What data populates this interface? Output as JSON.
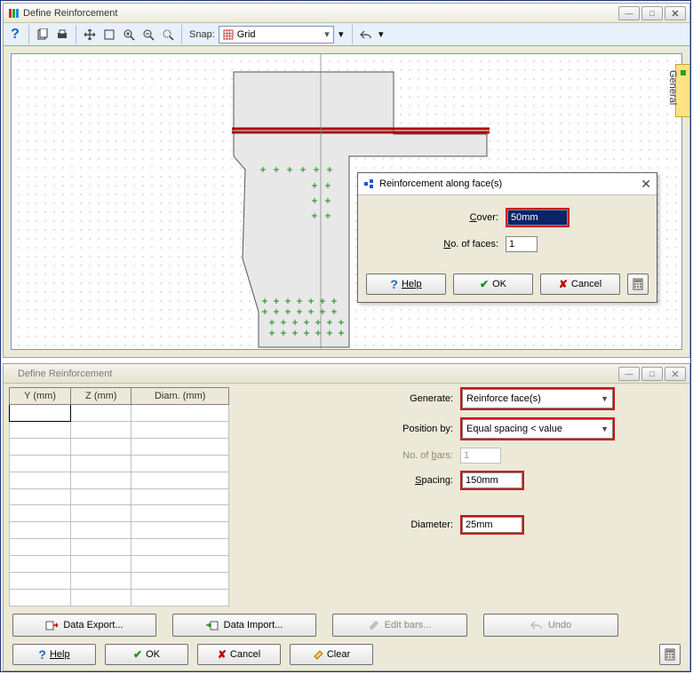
{
  "top_panel": {
    "title": "Define Reinforcement",
    "toolbar": {
      "snap_label": "Snap:",
      "snap_value": "Grid"
    },
    "side_tab": "General"
  },
  "dialog": {
    "title": "Reinforcement along face(s)",
    "cover_label": "Cover:",
    "cover_value": "50mm",
    "faces_label": "No. of faces:",
    "faces_value": "1",
    "help": "Help",
    "ok": "OK",
    "cancel": "Cancel"
  },
  "bottom_panel": {
    "title": "Define Reinforcement",
    "table_headers": [
      "Y (mm)",
      "Z (mm)",
      "Diam. (mm)"
    ],
    "generate_label": "Generate:",
    "generate_value": "Reinforce face(s)",
    "position_label": "Position by:",
    "position_value": "Equal spacing < value",
    "nobars_label": "No. of bars:",
    "nobars_value": "1",
    "spacing_label": "Spacing:",
    "spacing_value": "150mm",
    "diameter_label": "Diameter:",
    "diameter_value": "25mm",
    "data_export": "Data Export...",
    "data_import": "Data Import...",
    "edit_bars": "Edit bars...",
    "undo": "Undo",
    "help": "Help",
    "ok": "OK",
    "cancel": "Cancel",
    "clear": "Clear"
  }
}
